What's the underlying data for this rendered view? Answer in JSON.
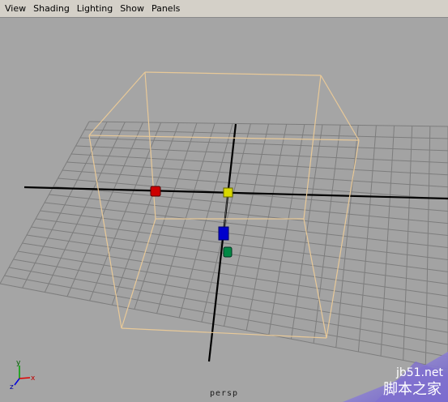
{
  "menu": {
    "items": [
      {
        "label": "View"
      },
      {
        "label": "Shading"
      },
      {
        "label": "Lighting"
      },
      {
        "label": "Show"
      },
      {
        "label": "Panels"
      }
    ]
  },
  "viewport": {
    "camera_label": "persp",
    "colors": {
      "background": "#a5a5a5",
      "grid": "#7d7d7d",
      "axis": "#000000",
      "bounding_box": "#e8c998",
      "handle_x": "#cc0000",
      "handle_center": "#d8d800",
      "handle_z": "#0000cc",
      "handle_y": "#008844"
    },
    "axis_indicator": {
      "y_label": "y",
      "x_label": "x",
      "z_label": "z"
    }
  },
  "watermark": {
    "url": "jb51.net",
    "text": "脚本之家"
  }
}
